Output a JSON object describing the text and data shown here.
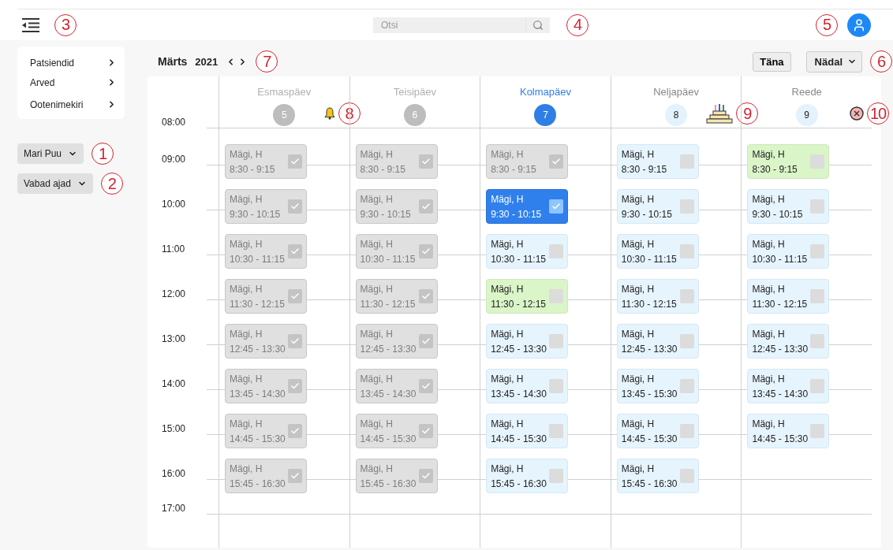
{
  "topbar": {
    "menu_callout": "3",
    "search": {
      "placeholder": "Otsi",
      "callout": "4"
    },
    "avatar_callout": "5"
  },
  "sidebar": {
    "items": [
      {
        "label": "Patsiendid"
      },
      {
        "label": "Arved"
      },
      {
        "label": "Ootenimekiri"
      }
    ],
    "dropdowns": [
      {
        "label": "Mari Puu",
        "callout": "1"
      },
      {
        "label": "Vabad ajad",
        "callout": "2"
      }
    ]
  },
  "calendar": {
    "month": "Märts",
    "year": "2021",
    "nav_callout": "7",
    "today_button": "Täna",
    "view_select": {
      "label": "Nädal",
      "callout": "6"
    },
    "days": [
      {
        "name": "Esmaspäev",
        "date": "5",
        "kind": "past",
        "marker": {
          "kind": "bell"
        },
        "callout": "8"
      },
      {
        "name": "Teisipäev",
        "date": "6",
        "kind": "past"
      },
      {
        "name": "Kolmapäev",
        "date": "7",
        "kind": "today"
      },
      {
        "name": "Neljapäev",
        "date": "8",
        "kind": "future",
        "marker": {
          "kind": "cake"
        },
        "callout": "9"
      },
      {
        "name": "Reede",
        "date": "9",
        "kind": "future",
        "marker": {
          "kind": "cancel"
        },
        "callout": "10"
      }
    ],
    "rows": [
      {
        "time": "08:00"
      },
      {
        "time": "09:00",
        "slots": [
          {
            "name": "Mägi, H",
            "time": "8:30 - 9:15",
            "kind": "past",
            "checked": true
          },
          {
            "name": "Mägi, H",
            "time": "8:30 - 9:15",
            "kind": "past",
            "checked": true
          },
          {
            "name": "Mägi, H",
            "time": "8:30 - 9:15",
            "kind": "past",
            "checked": true
          },
          {
            "name": "Mägi, H",
            "time": "8:30 - 9:15",
            "kind": "free",
            "checked": false
          },
          {
            "name": "Mägi, H",
            "time": "8:30 - 9:15",
            "kind": "green",
            "checked": false
          }
        ]
      },
      {
        "time": "10:00",
        "slots": [
          {
            "name": "Mägi, H",
            "time": "9:30 - 10:15",
            "kind": "past",
            "checked": true
          },
          {
            "name": "Mägi, H",
            "time": "9:30 - 10:15",
            "kind": "past",
            "checked": true
          },
          {
            "name": "Mägi, H",
            "time": "9:30 - 10:15",
            "kind": "booked",
            "checked": true
          },
          {
            "name": "Mägi, H",
            "time": "9:30 - 10:15",
            "kind": "free",
            "checked": false
          },
          {
            "name": "Mägi, H",
            "time": "9:30 - 10:15",
            "kind": "free",
            "checked": false
          }
        ]
      },
      {
        "time": "11:00",
        "slots": [
          {
            "name": "Mägi, H",
            "time": "10:30 - 11:15",
            "kind": "past",
            "checked": true
          },
          {
            "name": "Mägi, H",
            "time": "10:30 - 11:15",
            "kind": "past",
            "checked": true
          },
          {
            "name": "Mägi, H",
            "time": "10:30 - 11:15",
            "kind": "free",
            "checked": false
          },
          {
            "name": "Mägi, H",
            "time": "10:30 - 11:15",
            "kind": "free",
            "checked": false
          },
          {
            "name": "Mägi, H",
            "time": "10:30 - 11:15",
            "kind": "free",
            "checked": false
          }
        ]
      },
      {
        "time": "12:00",
        "slots": [
          {
            "name": "Mägi, H",
            "time": "11:30 - 12:15",
            "kind": "past",
            "checked": true
          },
          {
            "name": "Mägi, H",
            "time": "11:30 - 12:15",
            "kind": "past",
            "checked": true
          },
          {
            "name": "Mägi, H",
            "time": "11:30 - 12:15",
            "kind": "green",
            "checked": false
          },
          {
            "name": "Mägi, H",
            "time": "11:30 - 12:15",
            "kind": "free",
            "checked": false
          },
          {
            "name": "Mägi, H",
            "time": "11:30 - 12:15",
            "kind": "free",
            "checked": false
          }
        ]
      },
      {
        "time": "13:00",
        "slots": [
          {
            "name": "Mägi, H",
            "time": "12:45 - 13:30",
            "kind": "past",
            "checked": true
          },
          {
            "name": "Mägi, H",
            "time": "12:45 - 13:30",
            "kind": "past",
            "checked": true
          },
          {
            "name": "Mägi, H",
            "time": "12:45 - 13:30",
            "kind": "free",
            "checked": false
          },
          {
            "name": "Mägi, H",
            "time": "12:45 - 13:30",
            "kind": "free",
            "checked": false
          },
          {
            "name": "Mägi, H",
            "time": "12:45 - 13:30",
            "kind": "free",
            "checked": false
          }
        ]
      },
      {
        "time": "14:00",
        "slots": [
          {
            "name": "Mägi, H",
            "time": "13:45 - 14:30",
            "kind": "past",
            "checked": true
          },
          {
            "name": "Mägi, H",
            "time": "13:45 - 14:30",
            "kind": "past",
            "checked": true
          },
          {
            "name": "Mägi, H",
            "time": "13:45 - 14:30",
            "kind": "free",
            "checked": false
          },
          {
            "name": "Mägi, H",
            "time": "13:45 - 15:30",
            "kind": "free",
            "checked": false
          },
          {
            "name": "Mägi, H",
            "time": "13:45 - 14:30",
            "kind": "free",
            "checked": false
          }
        ]
      },
      {
        "time": "15:00",
        "slots": [
          {
            "name": "Mägi, H",
            "time": "14:45 - 15:30",
            "kind": "past",
            "checked": true
          },
          {
            "name": "Mägi, H",
            "time": "14:45 - 15:30",
            "kind": "past",
            "checked": true
          },
          {
            "name": "Mägi, H",
            "time": "14:45 - 15:30",
            "kind": "free",
            "checked": false
          },
          {
            "name": "Mägi, H",
            "time": "14:45 - 15:30",
            "kind": "free",
            "checked": false
          },
          {
            "name": "Mägi, H",
            "time": "14:45 - 15:30",
            "kind": "free",
            "checked": false
          }
        ]
      },
      {
        "time": "16:00",
        "slots": [
          {
            "name": "Mägi, H",
            "time": "15:45 - 16:30",
            "kind": "past",
            "checked": true
          },
          {
            "name": "Mägi, H",
            "time": "15:45 - 16:30",
            "kind": "past",
            "checked": true
          },
          {
            "name": "Mägi, H",
            "time": "15:45 - 16:30",
            "kind": "free",
            "checked": false
          },
          {
            "name": "Mägi, H",
            "time": "15:45 - 16:30",
            "kind": "free",
            "checked": false
          }
        ]
      },
      {
        "time": "17:00"
      }
    ]
  }
}
